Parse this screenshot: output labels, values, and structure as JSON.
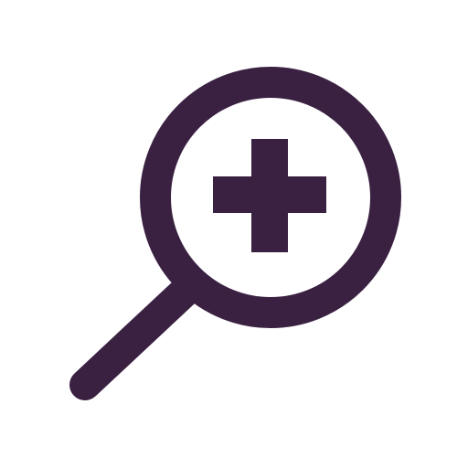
{
  "icon": {
    "name": "zoom-in-icon",
    "color": "#3a2142",
    "background": "#ffffff"
  }
}
